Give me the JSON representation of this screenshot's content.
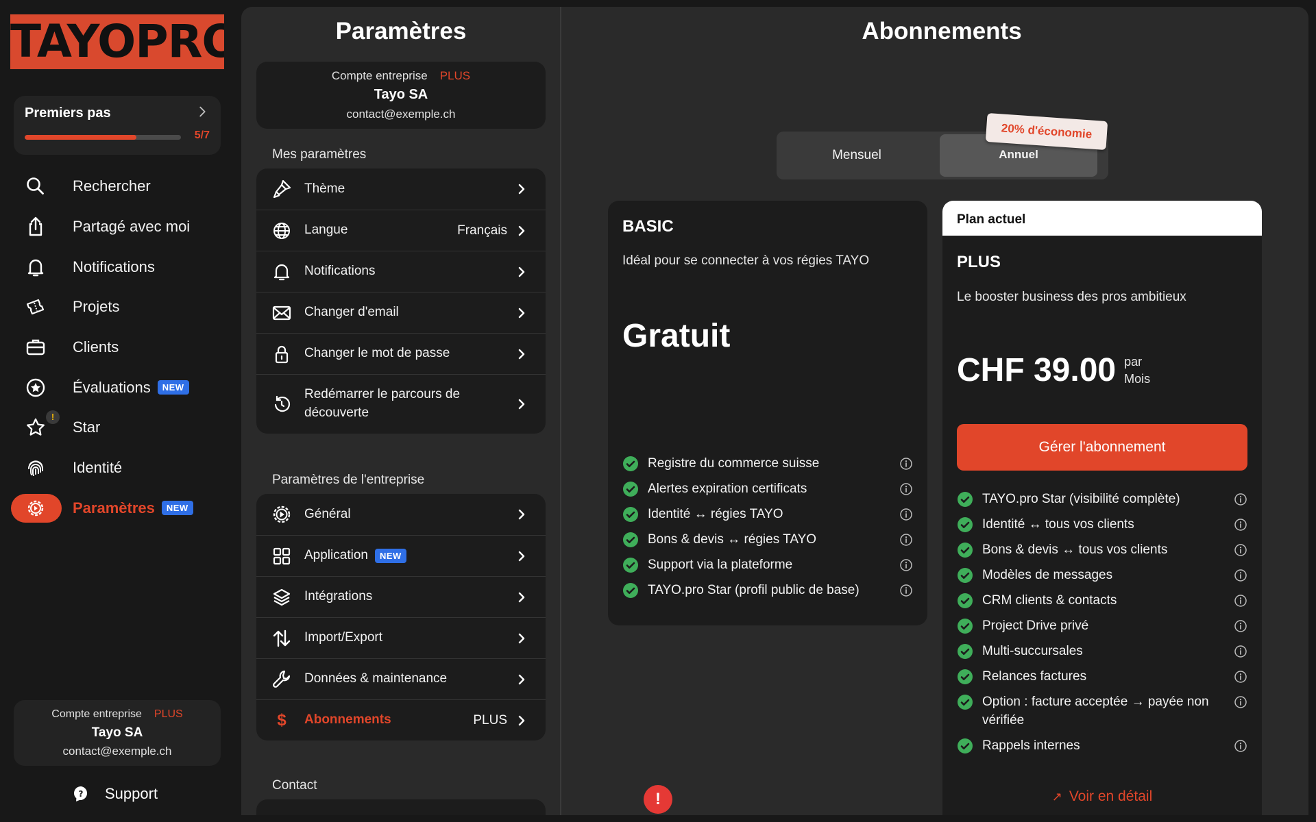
{
  "brand": {
    "logo_text": "TAYOPRO",
    "accent": "#e1462a",
    "new_badge": "#2f6fe6"
  },
  "onboarding": {
    "title": "Premiers pas",
    "progress_text": "5/7",
    "progress": 0.714
  },
  "nav": {
    "items": [
      {
        "label": "Rechercher",
        "icon": "search-icon"
      },
      {
        "label": "Partagé avec moi",
        "icon": "share-icon"
      },
      {
        "label": "Notifications",
        "icon": "bell-icon"
      },
      {
        "label": "Projets",
        "icon": "tickets-icon"
      },
      {
        "label": "Clients",
        "icon": "briefcase-icon"
      },
      {
        "label": "Évaluations",
        "icon": "star-circle-icon",
        "badge": "NEW"
      },
      {
        "label": "Star",
        "icon": "star-icon",
        "warning": "!"
      },
      {
        "label": "Identité",
        "icon": "fingerprint-icon"
      },
      {
        "label": "Paramètres",
        "icon": "gear-icon",
        "badge": "NEW",
        "active": true
      }
    ]
  },
  "account": {
    "type": "Compte entreprise",
    "plan": "PLUS",
    "name": "Tayo SA",
    "email": "contact@exemple.ch"
  },
  "support": {
    "label": "Support"
  },
  "settings": {
    "title": "Paramètres",
    "my_section": "Mes paramètres",
    "my_items": [
      {
        "label": "Thème",
        "icon": "brush-icon"
      },
      {
        "label": "Langue",
        "value": "Français",
        "icon": "globe-icon"
      },
      {
        "label": "Notifications",
        "icon": "bell-icon"
      },
      {
        "label": "Changer d'email",
        "icon": "mail-icon"
      },
      {
        "label": "Changer le mot de passe",
        "icon": "lock-icon"
      },
      {
        "label": "Redémarrer le parcours de découverte",
        "icon": "restart-icon"
      }
    ],
    "company_section": "Paramètres de l'entreprise",
    "company_items": [
      {
        "label": "Général",
        "icon": "gear-icon"
      },
      {
        "label": "Application",
        "badge": "NEW",
        "icon": "grid-icon"
      },
      {
        "label": "Intégrations",
        "icon": "layers-icon"
      },
      {
        "label": "Import/Export",
        "icon": "swap-icon"
      },
      {
        "label": "Données & maintenance",
        "icon": "wrench-icon"
      },
      {
        "label": "Abonnements",
        "value": "PLUS",
        "icon": "dollar-icon",
        "active": true
      }
    ],
    "contact_section": "Contact"
  },
  "subscriptions": {
    "title": "Abonnements",
    "billing": {
      "monthly": "Mensuel",
      "annual": "Annuel",
      "selected": "Annuel",
      "promo": "20% d'économie"
    },
    "basic": {
      "name": "BASIC",
      "description": "Idéal pour se connecter à vos régies TAYO",
      "price": "Gratuit",
      "features": [
        "Registre du commerce suisse",
        "Alertes expiration certificats",
        "Identité ↔ régies TAYO",
        "Bons & devis ↔ régies TAYO",
        "Support via la plateforme",
        "TAYO.pro Star (profil public de base)"
      ]
    },
    "plus": {
      "current_label": "Plan actuel",
      "name": "PLUS",
      "description": "Le booster business des pros ambitieux",
      "price": "CHF 39.00",
      "price_per": "par",
      "price_unit": "Mois",
      "manage_button": "Gérer l'abonnement",
      "features": [
        "TAYO.pro Star (visibilité complète)",
        "Identité ↔ tous vos clients",
        "Bons & devis ↔ tous vos clients",
        "Modèles de messages",
        "CRM clients & contacts",
        "Project Drive privé",
        "Multi-succursales",
        "Relances factures",
        "Option : facture acceptée → payée non vérifiée",
        "Rappels internes"
      ],
      "detail_link": "Voir en détail"
    }
  },
  "alert_button": "!"
}
